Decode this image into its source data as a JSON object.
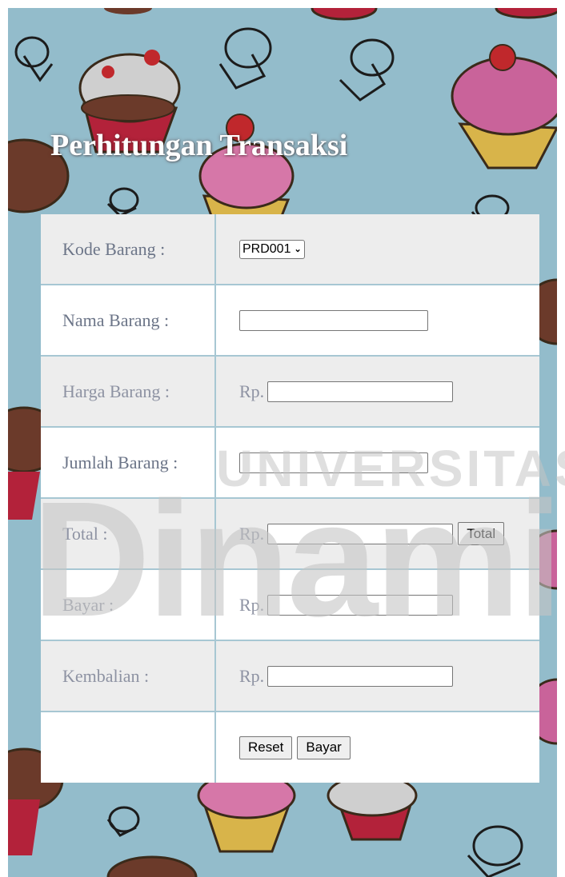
{
  "page": {
    "title": "Perhitungan Transaksi"
  },
  "form": {
    "kode": {
      "label": "Kode Barang :",
      "selected": "PRD001"
    },
    "nama": {
      "label": "Nama Barang :",
      "value": ""
    },
    "harga": {
      "label": "Harga Barang :",
      "prefix": "Rp.",
      "value": ""
    },
    "jumlah": {
      "label": "Jumlah Barang :",
      "value": ""
    },
    "total": {
      "label": "Total :",
      "prefix": "Rp.",
      "value": "",
      "button": "Total"
    },
    "bayar": {
      "label": "Bayar :",
      "prefix": "Rp.",
      "value": ""
    },
    "kembalian": {
      "label": "Kembalian :",
      "prefix": "Rp.",
      "value": ""
    },
    "actions": {
      "reset": "Reset",
      "submit": "Bayar"
    }
  },
  "watermark": {
    "line1": "UNIVERSITAS",
    "line2": "Dinami"
  },
  "colors": {
    "background": "#93bccb",
    "title": "#ffffff",
    "label": "#6c7588",
    "watermark": "#c9c9c9"
  }
}
